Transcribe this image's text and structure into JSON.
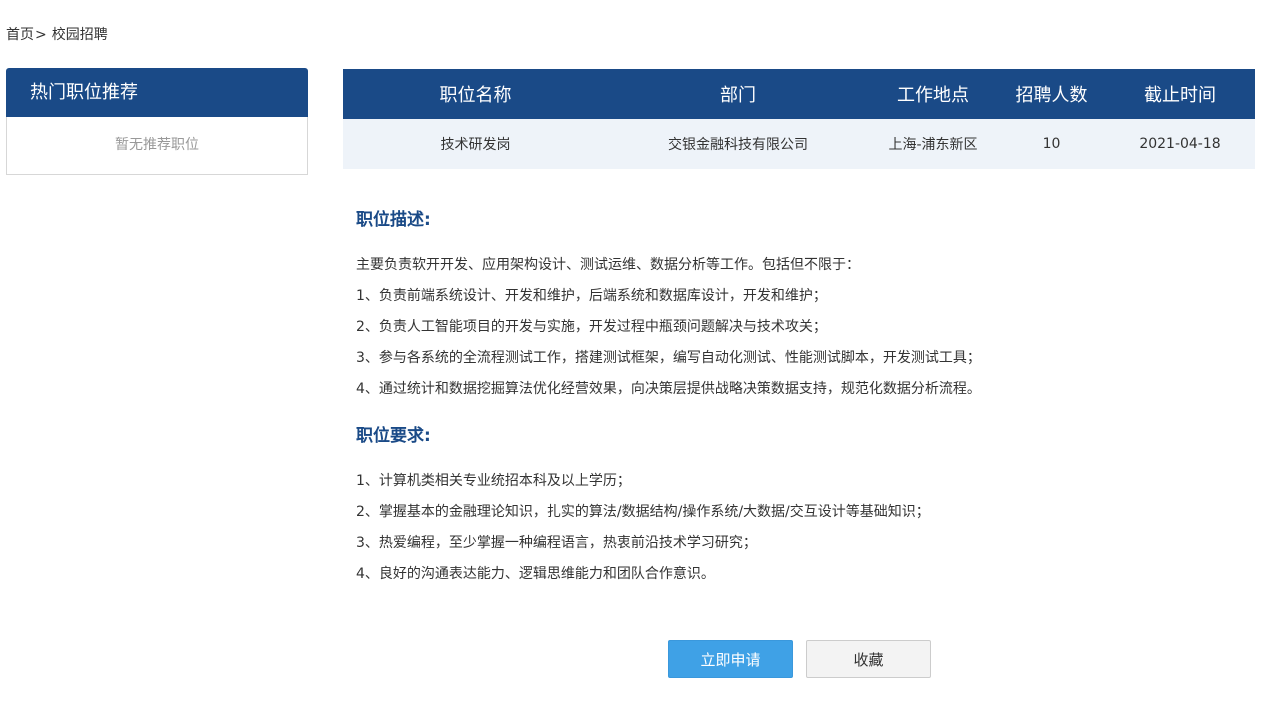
{
  "breadcrumb": {
    "home": "首页",
    "separator": ">",
    "current": "校园招聘"
  },
  "sidebar": {
    "title": "热门职位推荐",
    "empty_text": "暂无推荐职位"
  },
  "job_table": {
    "headers": [
      "职位名称",
      "部门",
      "工作地点",
      "招聘人数",
      "截止时间"
    ],
    "row": [
      "技术研发岗",
      "交银金融科技有限公司",
      "上海-浦东新区",
      "10",
      "2021-04-18"
    ]
  },
  "description": {
    "title": "职位描述:",
    "items": [
      "主要负责软开开发、应用架构设计、测试运维、数据分析等工作。包括但不限于：",
      "1、负责前端系统设计、开发和维护，后端系统和数据库设计，开发和维护；",
      "2、负责人工智能项目的开发与实施，开发过程中瓶颈问题解决与技术攻关；",
      "3、参与各系统的全流程测试工作，搭建测试框架，编写自动化测试、性能测试脚本，开发测试工具；",
      "4、通过统计和数据挖掘算法优化经营效果，向决策层提供战略决策数据支持，规范化数据分析流程。"
    ]
  },
  "requirements": {
    "title": "职位要求:",
    "items": [
      "1、计算机类相关专业统招本科及以上学历；",
      "2、掌握基本的金融理论知识，扎实的算法/数据结构/操作系统/大数据/交互设计等基础知识；",
      "3、热爱编程，至少掌握一种编程语言，热衷前沿技术学习研究；",
      "4、良好的沟通表达能力、逻辑思维能力和团队合作意识。"
    ]
  },
  "actions": {
    "apply_label": "立即申请",
    "favorite_label": "收藏"
  },
  "colors": {
    "primary": "#1a4a87",
    "apply_button": "#3fa1e6",
    "row_background": "#eef3f9"
  }
}
